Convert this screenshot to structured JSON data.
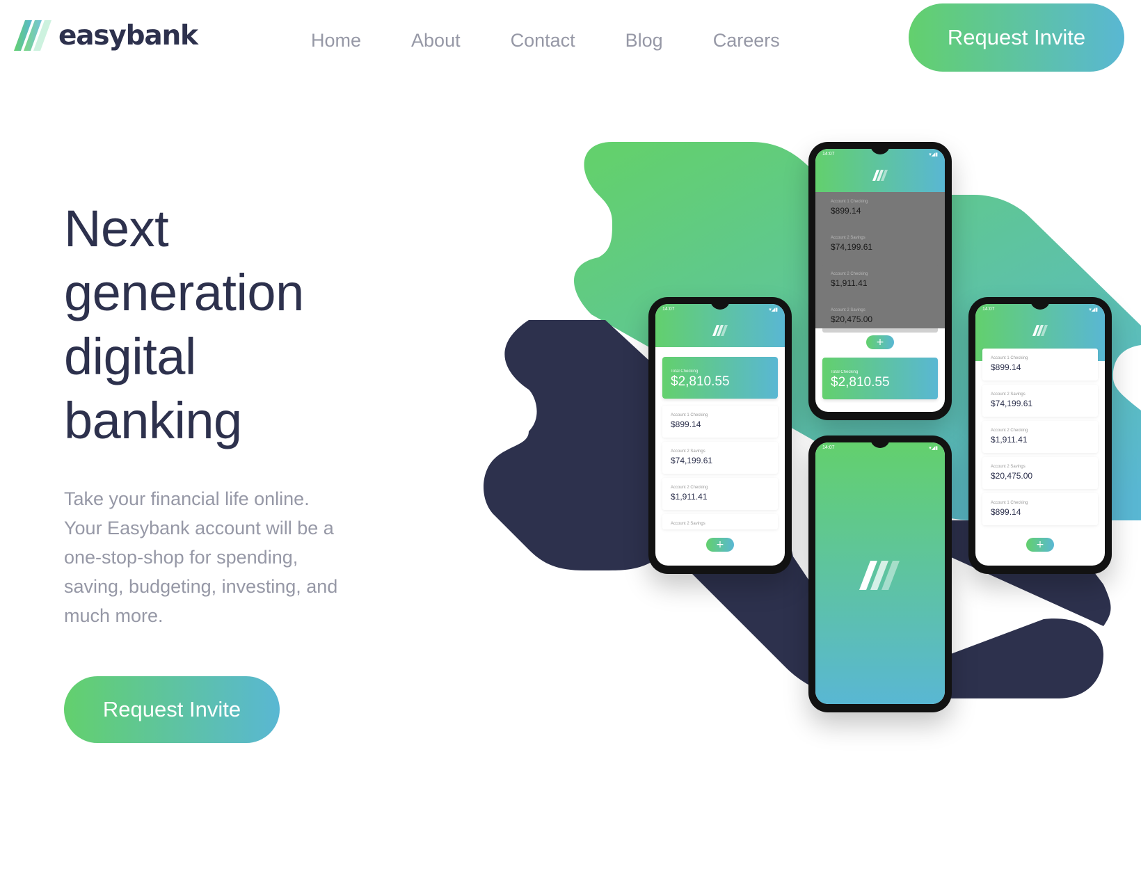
{
  "brand": {
    "name": "easybank"
  },
  "nav": {
    "links": [
      "Home",
      "About",
      "Contact",
      "Blog",
      "Careers"
    ]
  },
  "header": {
    "cta_label": "Request Invite"
  },
  "hero": {
    "title_lines": [
      "Next",
      "generation",
      "digital",
      "banking"
    ],
    "description_lines": [
      "Take your financial life online.",
      "Your Easybank account will be a",
      "one-stop-shop for spending,",
      "saving, budgeting, investing, and",
      "much more."
    ],
    "cta_label": "Request Invite"
  },
  "colors": {
    "navy": "#2d314d",
    "gray_text": "#9698a6",
    "lime_green": "#63d06d",
    "bright_cyan": "#59b7d3"
  },
  "mockup": {
    "status_time": "14:07",
    "total": {
      "label": "Total Checking",
      "amount": "$2,810.55"
    },
    "accounts": [
      {
        "label": "Account 1 Checking",
        "amount": "$899.14"
      },
      {
        "label": "Account 2 Savings",
        "amount": "$74,199.61"
      },
      {
        "label": "Account 2 Checking",
        "amount": "$1,911.41"
      },
      {
        "label": "Account 2 Savings",
        "amount": "$20,475.00"
      },
      {
        "label": "Account 1 Checking",
        "amount": "$899.14"
      }
    ],
    "fab_symbol": "+"
  }
}
